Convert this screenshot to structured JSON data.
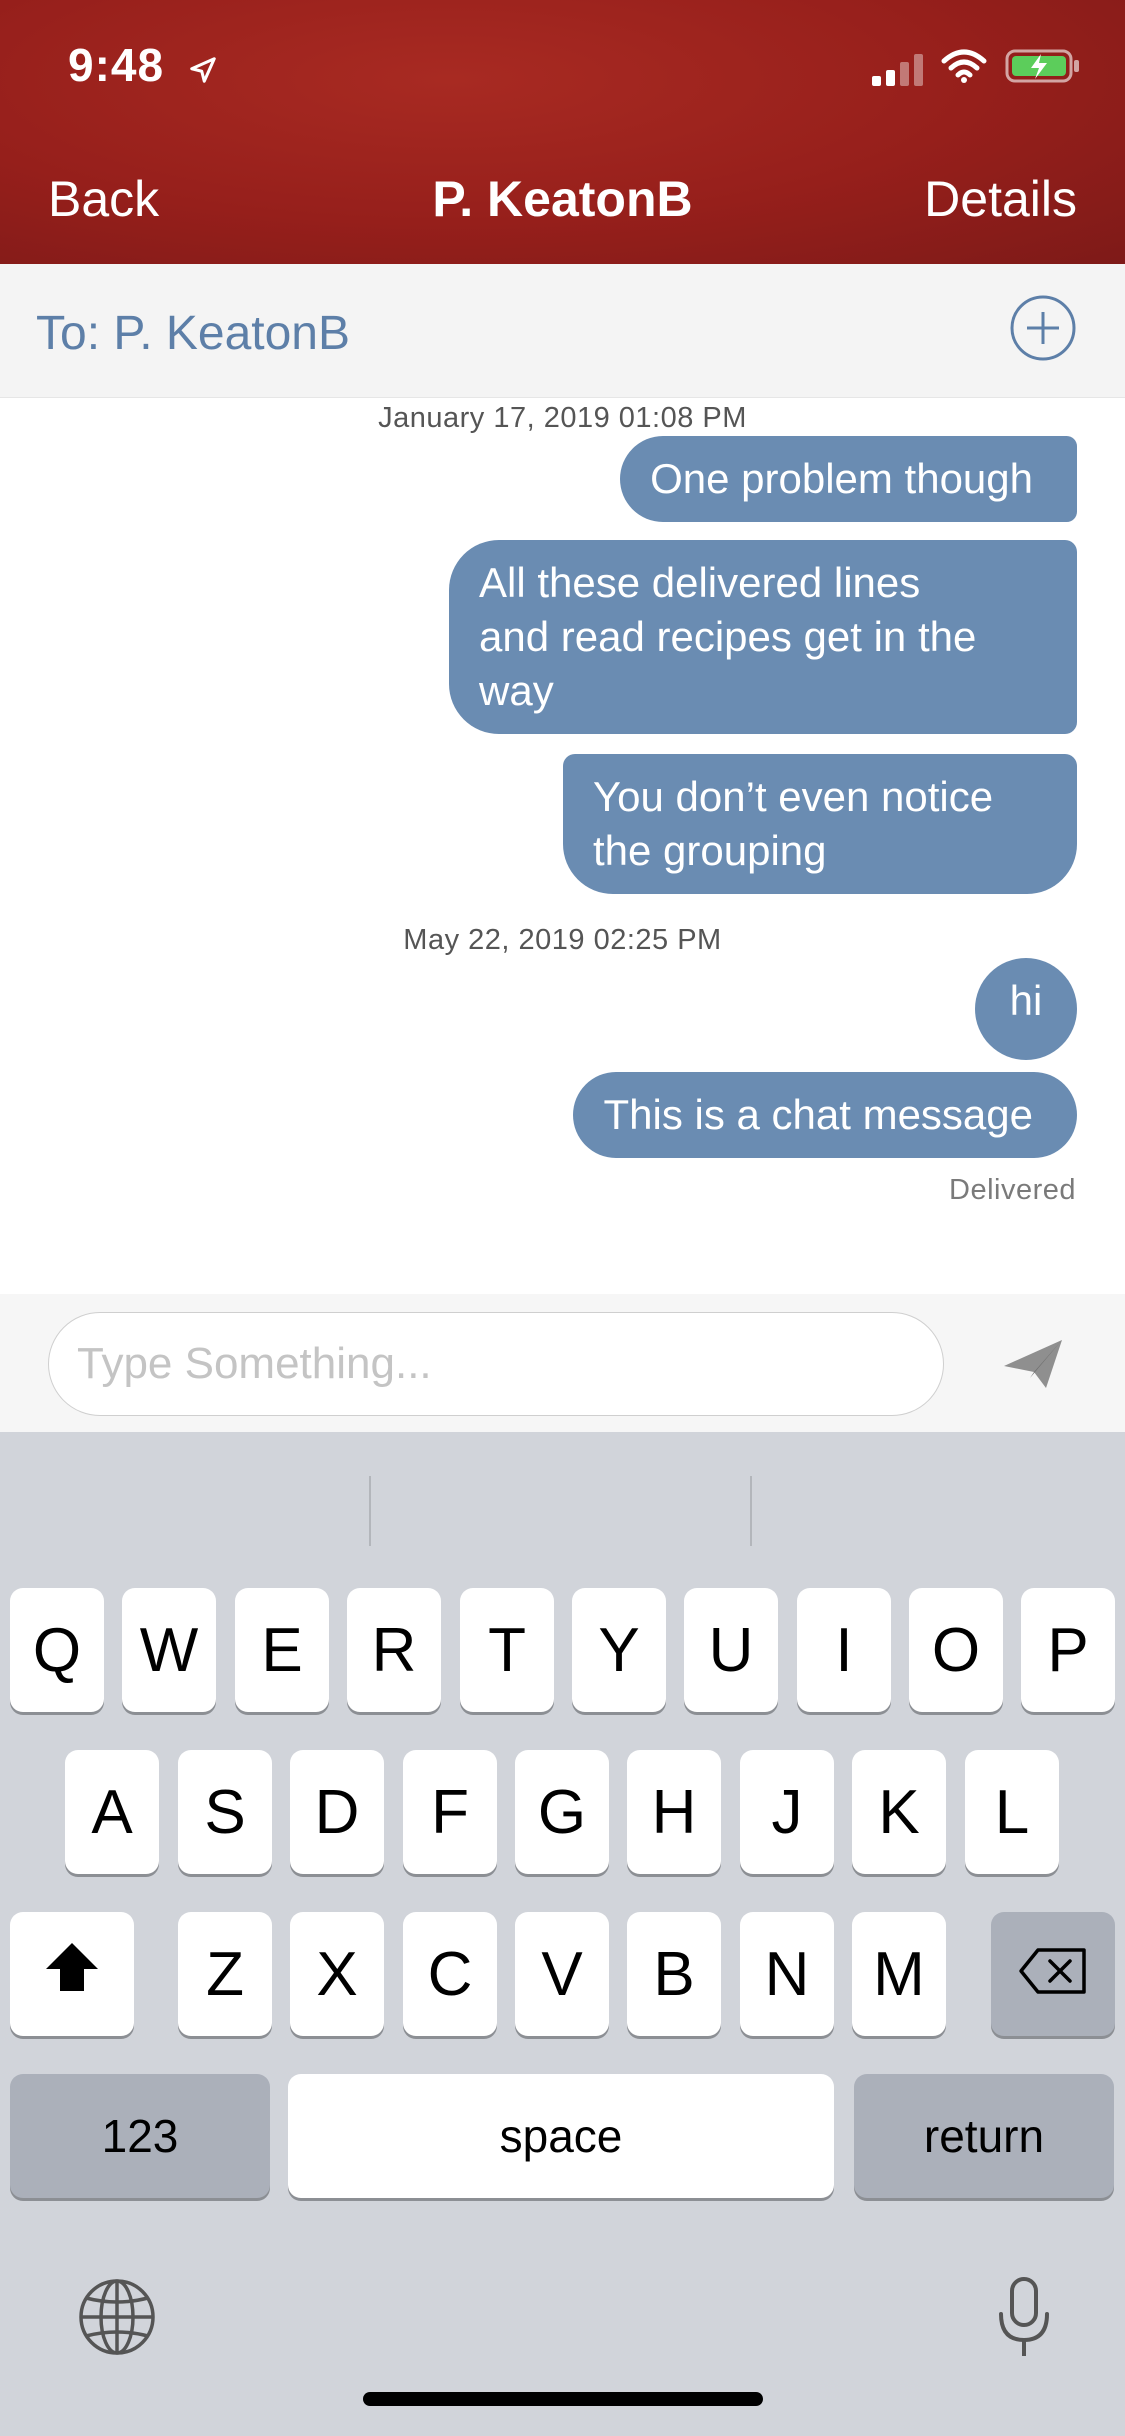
{
  "status": {
    "time": "9:48"
  },
  "nav": {
    "back": "Back",
    "title": "P. KeatonB",
    "details": "Details"
  },
  "to": {
    "label": "To:  P. KeatonB"
  },
  "messages": {
    "timestamp_1": "January 17, 2019 01:08 PM",
    "m1": "One problem though",
    "m2_line1": "All these delivered lines",
    "m2_line2": "and read recipes get in the",
    "m2_line3": "way",
    "m3_line1": "You don’t even notice",
    "m3_line2": "the grouping",
    "timestamp_2": "May 22, 2019 02:25 PM",
    "m4": "hi",
    "m5": "This is a chat message",
    "delivered": "Delivered"
  },
  "input": {
    "placeholder": "Type Something..."
  },
  "keyboard": {
    "row1": [
      "Q",
      "W",
      "E",
      "R",
      "T",
      "Y",
      "U",
      "I",
      "O",
      "P"
    ],
    "row2": [
      "A",
      "S",
      "D",
      "F",
      "G",
      "H",
      "J",
      "K",
      "L"
    ],
    "row3": [
      "Z",
      "X",
      "C",
      "V",
      "B",
      "N",
      "M"
    ],
    "numbers": "123",
    "space": "space",
    "return": "return"
  },
  "colors": {
    "header": "#961f1b",
    "bubble": "#6a8cb2",
    "accent": "#5d7fa8"
  },
  "icons": [
    "location-arrow-icon",
    "cellular-icon",
    "wifi-icon",
    "battery-charging-icon",
    "add-circle-icon",
    "send-icon",
    "shift-icon",
    "backspace-icon",
    "globe-icon",
    "microphone-icon"
  ]
}
